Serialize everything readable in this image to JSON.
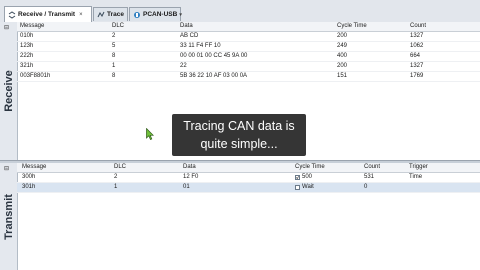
{
  "tabs": [
    {
      "label": "Receive / Transmit",
      "close": "×",
      "icon": "receive-transmit-icon"
    },
    {
      "label": "Trace",
      "icon": "trace-icon"
    },
    {
      "label": "PCAN-USB",
      "dropdown": "▾",
      "icon": "usb-connector-icon"
    }
  ],
  "receive": {
    "side_label": "Receive",
    "columns": {
      "message": "Message",
      "dlc": "DLC",
      "data": "Data",
      "cycle_time": "Cycle Time",
      "count": "Count"
    },
    "rows": [
      {
        "message": "010h",
        "dlc": "2",
        "data": "AB CD",
        "cycle_time": "200",
        "count": "1327"
      },
      {
        "message": "123h",
        "dlc": "5",
        "data": "33 11 F4 FF 10",
        "cycle_time": "249",
        "count": "1062"
      },
      {
        "message": "222h",
        "dlc": "8",
        "data": "00 00 01 00 CC 45 9A 00",
        "cycle_time": "400",
        "count": "664"
      },
      {
        "message": "321h",
        "dlc": "1",
        "data": "22",
        "cycle_time": "200",
        "count": "1327"
      },
      {
        "message": "003F8801h",
        "dlc": "8",
        "data": "5B 36 22 10 AF 03 00 0A",
        "cycle_time": "151",
        "count": "1769"
      }
    ]
  },
  "transmit": {
    "side_label": "Transmit",
    "columns": {
      "message": "Message",
      "dlc": "DLC",
      "data": "Data",
      "cycle_time": "Cycle Time",
      "count": "Count",
      "trigger": "Trigger"
    },
    "rows": [
      {
        "message": "300h",
        "dlc": "2",
        "data": "12 F0",
        "cycle_time": "500",
        "cycle_checked": true,
        "count": "531",
        "trigger": "Time"
      },
      {
        "message": "301h",
        "dlc": "1",
        "data": "01",
        "cycle_time": "Wait",
        "cycle_checked": false,
        "count": "0",
        "trigger": ""
      }
    ]
  },
  "tooltip": {
    "line1": "Tracing CAN data is",
    "line2": "quite simple..."
  },
  "colors": {
    "tooltip_bg": "#353535",
    "selected_row": "#d9e4f1",
    "side_panel": "#e4e8ee"
  }
}
